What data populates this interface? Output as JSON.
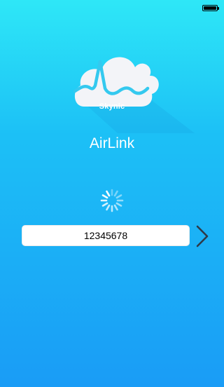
{
  "status_bar": {
    "battery_icon": "battery-full-icon"
  },
  "logo": {
    "icon": "cloud-pulse-logo-icon",
    "brand_name": "Skynic"
  },
  "app": {
    "title": "AirLink"
  },
  "loading": {
    "icon": "loading-spinner-icon"
  },
  "code_field": {
    "value": "12345678"
  },
  "next_button": {
    "icon": "chevron-right-icon"
  },
  "colors": {
    "gradient_top": "#2ee7f7",
    "gradient_bottom": "#1a9cf6",
    "cloud": "#f3f4f8",
    "pulse_line": "#34c9ef"
  }
}
